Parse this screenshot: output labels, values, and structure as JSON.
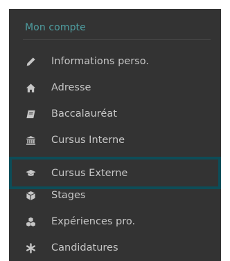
{
  "menu": {
    "title": "Mon compte",
    "items": [
      {
        "label": "Informations perso.",
        "icon": "pencil-icon"
      },
      {
        "label": "Adresse",
        "icon": "home-icon"
      },
      {
        "label": "Baccalauréat",
        "icon": "book-icon"
      },
      {
        "label": "Cursus Interne",
        "icon": "institution-icon"
      },
      {
        "label": "Cursus Externe",
        "icon": "graduation-cap-icon",
        "active": true
      },
      {
        "label": "Stages",
        "icon": "cube-icon"
      },
      {
        "label": "Expériences pro.",
        "icon": "cubes-icon"
      },
      {
        "label": "Candidatures",
        "icon": "asterisk-icon"
      }
    ]
  },
  "colors": {
    "panel_background": "#333333",
    "title_accent": "#4f9fa2",
    "text": "#c6c6c6",
    "active_border": "#0d4d58"
  }
}
